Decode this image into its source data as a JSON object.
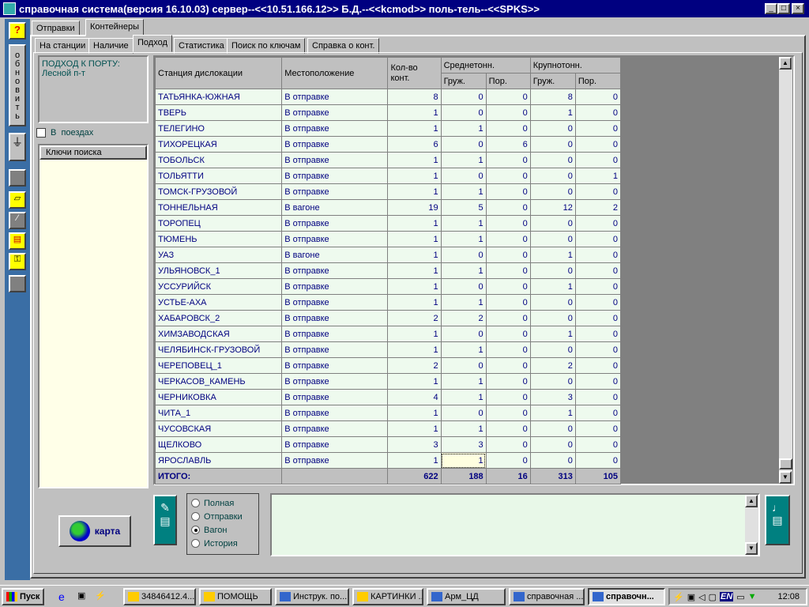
{
  "window": {
    "title": "справочная система(версия 16.10.03) сервер--<<10.51.166.12>> Б.Д.--<<kcmod>> поль-тель--<<SPKS>>"
  },
  "toolbar": {
    "help": "?",
    "refresh": "обновить"
  },
  "outer_tabs": [
    "Отправки",
    "Контейнеры"
  ],
  "inner_tabs": [
    "На станции",
    "Наличие",
    "Подход",
    "Статистика",
    "Поиск по ключам",
    "Справка о конт."
  ],
  "info": {
    "line1": "ПОДХОД К ПОРТУ:",
    "line2": "Лесной п-т"
  },
  "in_trains": {
    "label": "В  поездах",
    "checked": false
  },
  "keys_header": "Ключи поиска",
  "grid": {
    "headers": {
      "station": "Станция дислокации",
      "location": "Местоположение",
      "count": "Кол-во конт.",
      "medium": "Среднетонн.",
      "large": "Крупнотонн.",
      "loaded": "Груж.",
      "empty": "Пор."
    },
    "rows": [
      [
        "ТАТЬЯНКА-ЮЖНАЯ",
        "В отправке",
        8,
        0,
        0,
        8,
        0
      ],
      [
        "ТВЕРЬ",
        "В отправке",
        1,
        0,
        0,
        1,
        0
      ],
      [
        "ТЕЛЕГИНО",
        "В отправке",
        1,
        1,
        0,
        0,
        0
      ],
      [
        "ТИХОРЕЦКАЯ",
        "В отправке",
        6,
        0,
        6,
        0,
        0
      ],
      [
        "ТОБОЛЬСК",
        "В отправке",
        1,
        1,
        0,
        0,
        0
      ],
      [
        "ТОЛЬЯТТИ",
        "В отправке",
        1,
        0,
        0,
        0,
        1
      ],
      [
        "ТОМСК-ГРУЗОВОЙ",
        "В отправке",
        1,
        1,
        0,
        0,
        0
      ],
      [
        "ТОННЕЛЬНАЯ",
        "В вагоне",
        19,
        5,
        0,
        12,
        2
      ],
      [
        "ТОРОПЕЦ",
        "В отправке",
        1,
        1,
        0,
        0,
        0
      ],
      [
        "ТЮМЕНЬ",
        "В отправке",
        1,
        1,
        0,
        0,
        0
      ],
      [
        "УАЗ",
        "В вагоне",
        1,
        0,
        0,
        1,
        0
      ],
      [
        "УЛЬЯНОВСК_1",
        "В отправке",
        1,
        1,
        0,
        0,
        0
      ],
      [
        "УССУРИЙСК",
        "В отправке",
        1,
        0,
        0,
        1,
        0
      ],
      [
        "УСТЬЕ-АХА",
        "В отправке",
        1,
        1,
        0,
        0,
        0
      ],
      [
        "ХАБАРОВСК_2",
        "В отправке",
        2,
        2,
        0,
        0,
        0
      ],
      [
        "ХИМЗАВОДСКАЯ",
        "В отправке",
        1,
        0,
        0,
        1,
        0
      ],
      [
        "ЧЕЛЯБИНСК-ГРУЗОВОЙ",
        "В отправке",
        1,
        1,
        0,
        0,
        0
      ],
      [
        "ЧЕРЕПОВЕЦ_1",
        "В отправке",
        2,
        0,
        0,
        2,
        0
      ],
      [
        "ЧЕРКАСОВ_КАМЕНЬ",
        "В отправке",
        1,
        1,
        0,
        0,
        0
      ],
      [
        "ЧЕРНИКОВКА",
        "В отправке",
        4,
        1,
        0,
        3,
        0
      ],
      [
        "ЧИТА_1",
        "В отправке",
        1,
        0,
        0,
        1,
        0
      ],
      [
        "ЧУСОВСКАЯ",
        "В отправке",
        1,
        1,
        0,
        0,
        0
      ],
      [
        "ЩЕЛКОВО",
        "В отправке",
        3,
        3,
        0,
        0,
        0
      ],
      [
        "ЯРОСЛАВЛЬ",
        "В отправке",
        1,
        1,
        0,
        0,
        0
      ]
    ],
    "total": [
      "ИТОГО:",
      "",
      622,
      188,
      16,
      313,
      105
    ]
  },
  "map_button": "карта",
  "modes": [
    {
      "label": "Полная",
      "selected": false
    },
    {
      "label": "Отправки",
      "selected": false
    },
    {
      "label": "Вагон",
      "selected": true
    },
    {
      "label": "История",
      "selected": false
    }
  ],
  "taskbar": {
    "start": "Пуск",
    "tasks": [
      "34846412.4...",
      "ПОМОЩЬ",
      "Инструк. по...",
      "КАРТИНКИ ...",
      "Арм_ЦД",
      "справочная ...",
      "справочн..."
    ],
    "clock": "12:08",
    "lang": "EN"
  }
}
